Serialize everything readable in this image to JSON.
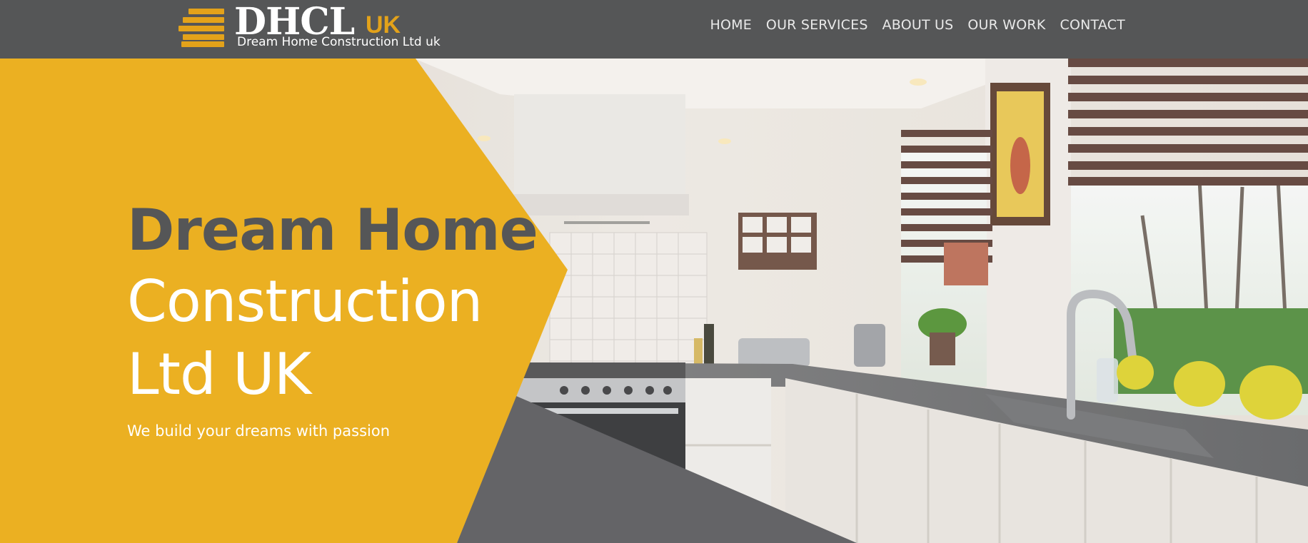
{
  "brand": {
    "name": "DHCL",
    "suffix": "UK",
    "tagline": "Dream Home Construction Ltd uk",
    "accent_color": "#e3a21a",
    "header_color": "#555657"
  },
  "nav": {
    "items": [
      {
        "label": "HOME"
      },
      {
        "label": "OUR SERVICES"
      },
      {
        "label": "ABOUT US"
      },
      {
        "label": "OUR WORK"
      },
      {
        "label": "CONTACT"
      }
    ]
  },
  "hero": {
    "line1": "Dream Home",
    "line2": "Construction",
    "line3": "Ltd UK",
    "tagline": "We build your dreams with passion",
    "panel_color": "#ebb022",
    "shadow_color": "#646467",
    "photo_subject": "kitchen-photo"
  }
}
